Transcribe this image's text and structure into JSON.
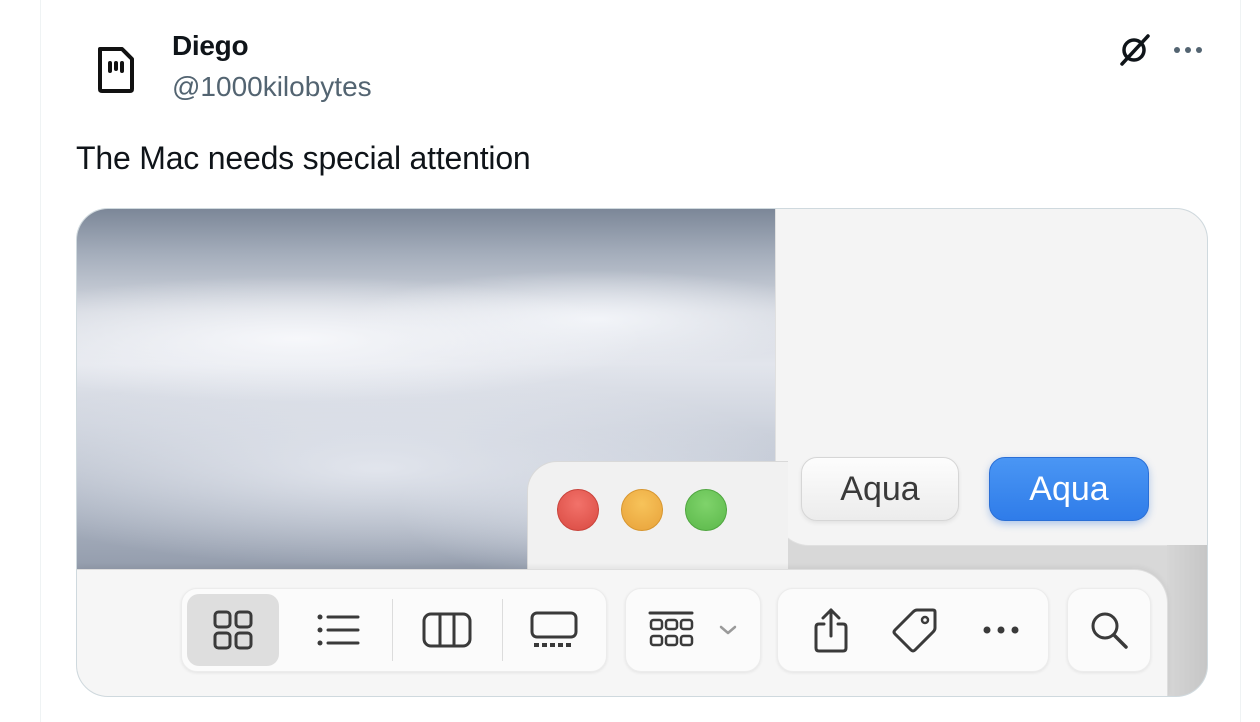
{
  "tweet": {
    "author_name": "Diego",
    "author_handle": "@1000kilobytes",
    "text": "The Mac needs special attention"
  },
  "media": {
    "buttons": [
      {
        "label": "Aqua",
        "style": "default"
      },
      {
        "label": "Aqua",
        "style": "primary"
      }
    ],
    "traffic_lights": [
      "close",
      "minimize",
      "zoom"
    ],
    "toolbar_icons": [
      "icon-view-grid",
      "list-view-icon",
      "column-view-icon",
      "gallery-view-icon",
      "group-by-icon",
      "chevron-down-icon",
      "share-icon",
      "tag-icon",
      "more-icon",
      "search-icon"
    ],
    "colors": {
      "accent_blue": "#2f7ce9",
      "red": "#e25a52",
      "yellow": "#f0b54a",
      "green": "#6ec55b"
    }
  }
}
